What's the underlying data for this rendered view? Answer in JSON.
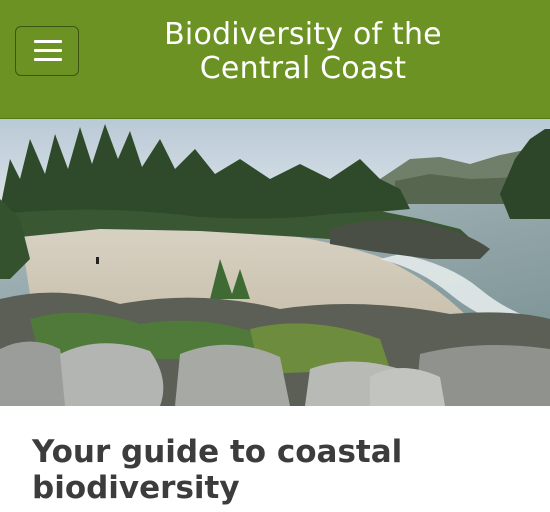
{
  "header": {
    "title_line1": "Biodiversity of the",
    "title_line2": "Central Coast",
    "background_color": "#6b9223",
    "menu_icon": "hamburger-menu-icon"
  },
  "hero": {
    "description": "Coastal photograph: sandy beach, rocky shoreline, evergreen forest"
  },
  "main": {
    "heading": "Your guide to coastal biodiversity",
    "heading_color": "#3c3c3c"
  }
}
